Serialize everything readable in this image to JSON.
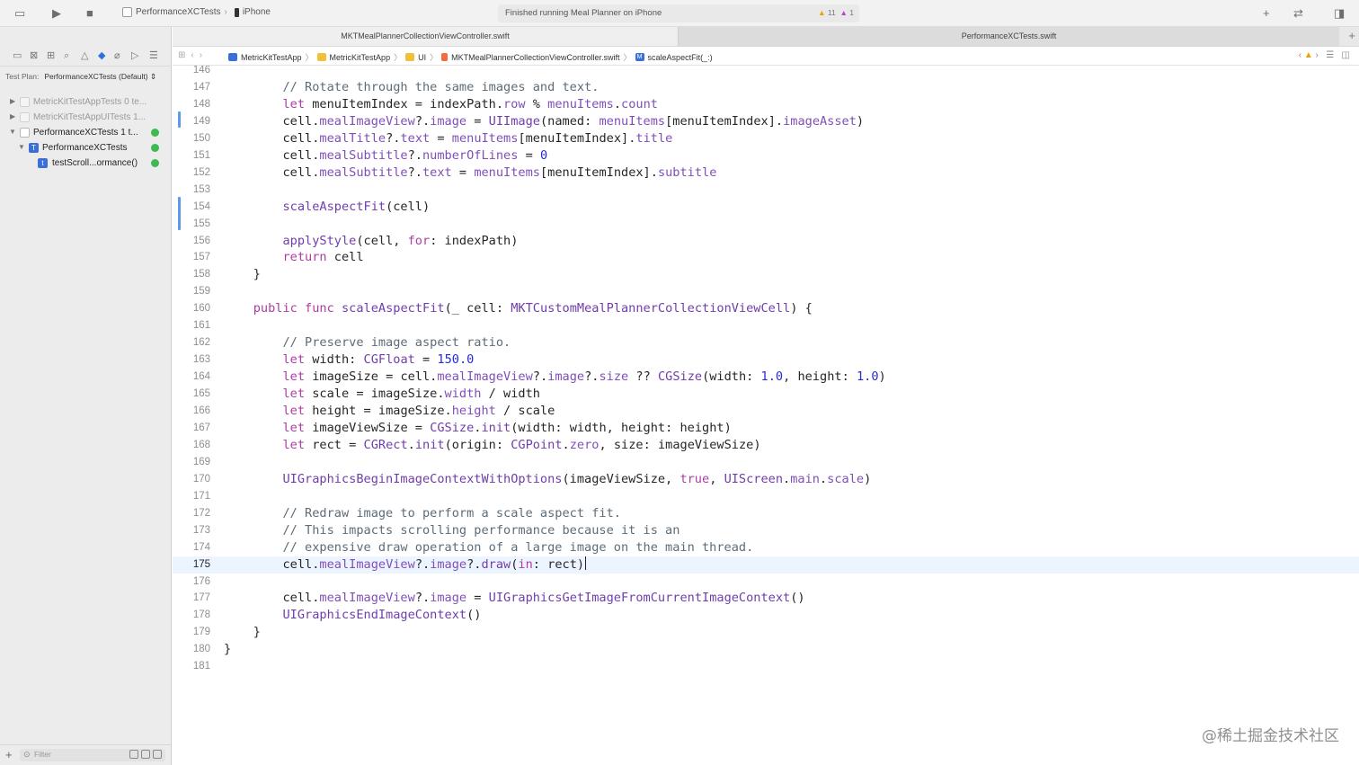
{
  "toolbar": {
    "scheme": "PerformanceXCTests",
    "destination": "iPhone",
    "status": "Finished running Meal Planner on iPhone",
    "warning_count": "11",
    "issue_count": "1"
  },
  "tabs": [
    {
      "label": "MKTMealPlannerCollectionViewController.swift"
    },
    {
      "label": "PerformanceXCTests.swift"
    }
  ],
  "navigator": {
    "test_plan_label": "Test Plan:",
    "test_plan_value": "PerformanceXCTests (Default) ⇕",
    "items": [
      {
        "label": "MetricKitTestAppTests 0 te...",
        "status": ""
      },
      {
        "label": "MetricKitTestAppUITests 1...",
        "status": ""
      },
      {
        "label": "PerformanceXCTests 1 t...",
        "status": "passed"
      },
      {
        "label": "PerformanceXCTests",
        "status": "passed"
      },
      {
        "label": "testScroll...ormance()",
        "status": "passed"
      }
    ],
    "filter_placeholder": "Filter"
  },
  "jumpbar": {
    "crumbs": [
      "MetricKitTestApp",
      "MetricKitTestApp",
      "UI",
      "MKTMealPlannerCollectionViewController.swift",
      "scaleAspectFit(_:)"
    ]
  },
  "editor": {
    "lines": [
      {
        "n": "146",
        "text": ""
      },
      {
        "n": "147",
        "text": "        // Rotate through the same images and text."
      },
      {
        "n": "148",
        "text": "        let menuItemIndex = indexPath.row % menuItems.count"
      },
      {
        "n": "149",
        "text": "        cell.mealImageView?.image = UIImage(named: menuItems[menuItemIndex].imageAsset)"
      },
      {
        "n": "150",
        "text": "        cell.mealTitle?.text = menuItems[menuItemIndex].title"
      },
      {
        "n": "151",
        "text": "        cell.mealSubtitle?.numberOfLines = 0"
      },
      {
        "n": "152",
        "text": "        cell.mealSubtitle?.text = menuItems[menuItemIndex].subtitle"
      },
      {
        "n": "153",
        "text": ""
      },
      {
        "n": "154",
        "text": "        scaleAspectFit(cell)"
      },
      {
        "n": "155",
        "text": ""
      },
      {
        "n": "156",
        "text": "        applyStyle(cell, for: indexPath)"
      },
      {
        "n": "157",
        "text": "        return cell"
      },
      {
        "n": "158",
        "text": "    }"
      },
      {
        "n": "159",
        "text": ""
      },
      {
        "n": "160",
        "text": "    public func scaleAspectFit(_ cell: MKTCustomMealPlannerCollectionViewCell) {"
      },
      {
        "n": "161",
        "text": ""
      },
      {
        "n": "162",
        "text": "        // Preserve image aspect ratio."
      },
      {
        "n": "163",
        "text": "        let width: CGFloat = 150.0"
      },
      {
        "n": "164",
        "text": "        let imageSize = cell.mealImageView?.image?.size ?? CGSize(width: 1.0, height: 1.0)"
      },
      {
        "n": "165",
        "text": "        let scale = imageSize.width / width"
      },
      {
        "n": "166",
        "text": "        let height = imageSize.height / scale"
      },
      {
        "n": "167",
        "text": "        let imageViewSize = CGSize.init(width: width, height: height)"
      },
      {
        "n": "168",
        "text": "        let rect = CGRect.init(origin: CGPoint.zero, size: imageViewSize)"
      },
      {
        "n": "169",
        "text": ""
      },
      {
        "n": "170",
        "text": "        UIGraphicsBeginImageContextWithOptions(imageViewSize, true, UIScreen.main.scale)"
      },
      {
        "n": "171",
        "text": ""
      },
      {
        "n": "172",
        "text": "        // Redraw image to perform a scale aspect fit."
      },
      {
        "n": "173",
        "text": "        // This impacts scrolling performance because it is an"
      },
      {
        "n": "174",
        "text": "        // expensive draw operation of a large image on the main thread."
      },
      {
        "n": "175",
        "text": "        cell.mealImageView?.image?.draw(in: rect)"
      },
      {
        "n": "176",
        "text": ""
      },
      {
        "n": "177",
        "text": "        cell.mealImageView?.image = UIGraphicsGetImageFromCurrentImageContext()"
      },
      {
        "n": "178",
        "text": "        UIGraphicsEndImageContext()"
      },
      {
        "n": "179",
        "text": "    }"
      },
      {
        "n": "180",
        "text": "}"
      },
      {
        "n": "181",
        "text": ""
      }
    ],
    "current_line": "175"
  },
  "watermark": "@稀土掘金技术社区",
  "colors": {
    "keyword": "#ad3da4",
    "comment": "#5d6c79",
    "member": "#804fb8",
    "number": "#272ad8",
    "change_bar": "#5b9ae8",
    "current_line": "#ecf5ff",
    "test_passed": "#3fb950",
    "warning": "#e7a300"
  }
}
